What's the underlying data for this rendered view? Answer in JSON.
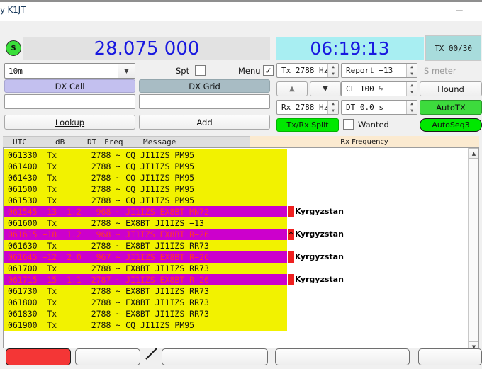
{
  "window": {
    "title": "y K1JT",
    "minimize_icon": "minimize-icon"
  },
  "top": {
    "s_indicator": "S",
    "frequency": "28.075 000",
    "utc_clock": "06:19:13",
    "tx_counter": "TX 00/30"
  },
  "left_panel": {
    "band": "10m",
    "band_arrow": "chevron-down-icon",
    "spt_label": "Spt",
    "spt_checked": "",
    "menu_label": "Menu",
    "menu_checked": "✓",
    "dx_call_label": "DX Call",
    "dx_call_value": "",
    "dx_grid_label": "DX Grid",
    "dx_grid_value": "",
    "lookup_label": "Lookup",
    "add_label": "Add"
  },
  "right_panel": {
    "tx_freq": "Tx  2788  Hz",
    "report": "Report −13",
    "s_meter_placeholder": "S meter",
    "up_arrow": "▲",
    "down_arrow": "▼",
    "cl": "CL  100 %",
    "hound_label": "Hound",
    "rx_freq": "Rx  2788  Hz",
    "dt": "DT 0.0 s",
    "autotx_label": "AutoTX",
    "txrx_split_label": "Tx/Rx Split",
    "wanted_label": "Wanted",
    "wanted_checked": "",
    "autoseq_label": "AutoSeq3"
  },
  "log": {
    "headers": [
      "UTC",
      "dB",
      "DT",
      "Freq",
      "Message"
    ],
    "rx_frequency_tab": "Rx Frequency",
    "rows": [
      {
        "text": "061330  Tx       2788 ~ CQ JI1IZS PM95",
        "type": "tx",
        "bg_width": 400,
        "tag": ""
      },
      {
        "text": "061400  Tx       2788 ~ CQ JI1IZS PM95",
        "type": "tx",
        "bg_width": 400,
        "tag": ""
      },
      {
        "text": "061430  Tx       2788 ~ CQ JI1IZS PM95",
        "type": "tx",
        "bg_width": 400,
        "tag": ""
      },
      {
        "text": "061500  Tx       2788 ~ CQ JI1IZS PM95",
        "type": "tx",
        "bg_width": 400,
        "tag": ""
      },
      {
        "text": "061530  Tx       2788 ~ CQ JI1IZS PM95",
        "type": "tx",
        "bg_width": 400,
        "tag": ""
      },
      {
        "text": "061545 −13  1.2   968 ~ JI1IZS EX8BT MN72",
        "type": "rx",
        "bg_width": 400,
        "tag": "Kyrgyzstan",
        "star": ""
      },
      {
        "text": "061600  Tx       2788 ~ EX8BT JI1IZS −13",
        "type": "tx",
        "bg_width": 400,
        "tag": ""
      },
      {
        "text": "061615 −18  1.2   968 ~ JI1IZS EX8BT R−26",
        "type": "rx",
        "bg_width": 400,
        "tag": "Kyrgyzstan",
        "star": "*"
      },
      {
        "text": "061630  Tx       2788 ~ EX8BT JI1IZS RR73",
        "type": "tx",
        "bg_width": 400,
        "tag": ""
      },
      {
        "text": "061645 −12  2.0   967 ~ JI1IZS EX8BT R−26",
        "type": "rx",
        "bg_width": 400,
        "tag": "Kyrgyzstan",
        "star": ""
      },
      {
        "text": "061700  Tx       2788 ~ EX8BT JI1IZS RR73",
        "type": "tx",
        "bg_width": 400,
        "tag": ""
      },
      {
        "text": "061715 −15  1.1  2787 ~ JI1IZS EX8BT R−26",
        "type": "rx",
        "bg_width": 400,
        "tag": "Kyrgyzstan",
        "star": ""
      },
      {
        "text": "061730  Tx       2788 ~ EX8BT JI1IZS RR73",
        "type": "tx",
        "bg_width": 400,
        "tag": ""
      },
      {
        "text": "061800  Tx       2788 ~ EX8BT JI1IZS RR73",
        "type": "tx",
        "bg_width": 400,
        "tag": ""
      },
      {
        "text": "061830  Tx       2788 ~ EX8BT JI1IZS RR73",
        "type": "tx",
        "bg_width": 400,
        "tag": ""
      },
      {
        "text": "061900  Tx       2788 ~ CQ JI1IZS PM95",
        "type": "tx",
        "bg_width": 400,
        "tag": ""
      }
    ],
    "scroll_up_icon": "scroll-up-arrow-icon",
    "scroll_down_icon": "scroll-down-arrow-icon"
  },
  "bottom": {
    "dropdown_arrow": "chevron-down-icon",
    "halt_label": "",
    "b2_label": "",
    "b4_label": "",
    "b5_label": "",
    "b6_label": ""
  },
  "colors": {
    "tx_row_bg": "#f2f200",
    "rx_row_bg": "#cc00cc",
    "rx_row_text": "#ff3333",
    "accent_blue": "#1818e0",
    "clock_bg": "#a8eef2",
    "green": "#00e800",
    "halt_red": "#f43636",
    "tag_swatch": "#ef2020"
  }
}
